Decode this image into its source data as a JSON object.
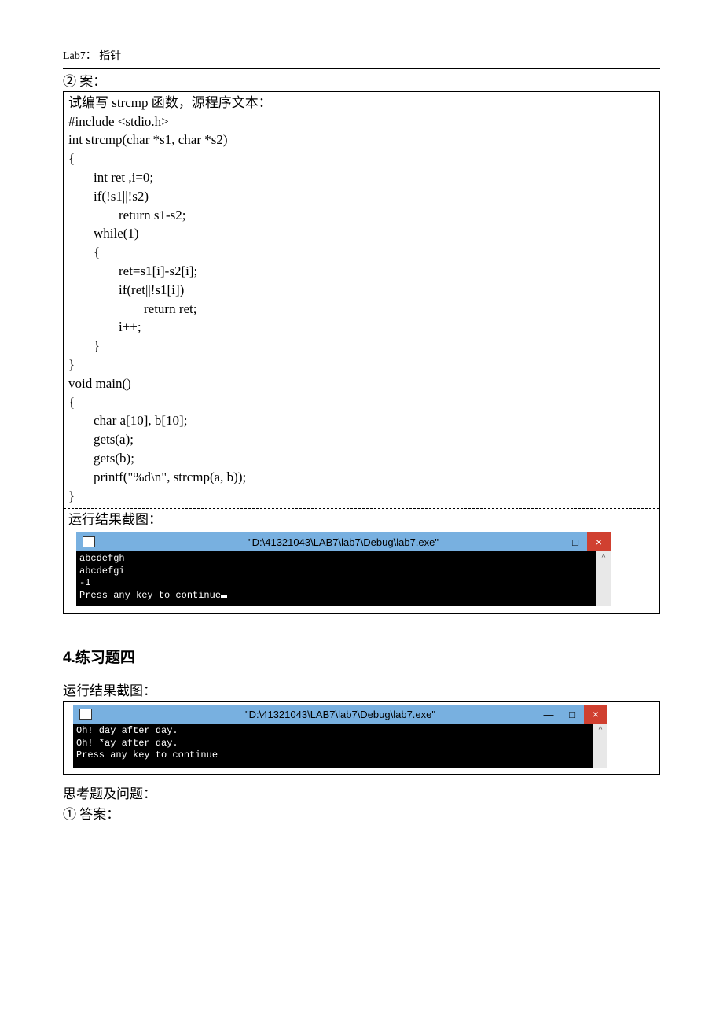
{
  "header": "Lab7：  指针",
  "item2_label": "② 案：",
  "box1": {
    "intro": "试编写 strcmp 函数，源程序文本：",
    "code": [
      {
        "t": "#include <stdio.h>",
        "i": 0
      },
      {
        "t": "int strcmp(char *s1, char *s2)",
        "i": 0
      },
      {
        "t": "{",
        "i": 0
      },
      {
        "t": "int ret ,i=0;",
        "i": 1
      },
      {
        "t": "if(!s1||!s2)",
        "i": 1
      },
      {
        "t": "return s1-s2;",
        "i": 2
      },
      {
        "t": "while(1)",
        "i": 1
      },
      {
        "t": "{",
        "i": 1
      },
      {
        "t": "ret=s1[i]-s2[i];",
        "i": 2
      },
      {
        "t": "if(ret||!s1[i])",
        "i": 2
      },
      {
        "t": "return ret;",
        "i": 3
      },
      {
        "t": "i++;",
        "i": 2
      },
      {
        "t": "}",
        "i": 1
      },
      {
        "t": "}",
        "i": 0
      },
      {
        "t": "void main()",
        "i": 0
      },
      {
        "t": "{",
        "i": 0
      },
      {
        "t": "char a[10], b[10];",
        "i": 1
      },
      {
        "t": "gets(a);",
        "i": 1
      },
      {
        "t": "gets(b);",
        "i": 1
      },
      {
        "t": "printf(\"%d\\n\", strcmp(a, b));",
        "i": 1
      },
      {
        "t": "}",
        "i": 0
      }
    ],
    "result_label": "运行结果截图：",
    "console_title": "\"D:\\41321043\\LAB7\\lab7\\Debug\\lab7.exe\"",
    "console_lines": "abcdefgh\nabcdefgi\n-1\nPress any key to continue"
  },
  "section4_title": "4.练习题四",
  "box2": {
    "result_label": "运行结果截图：",
    "console_title": "\"D:\\41321043\\LAB7\\lab7\\Debug\\lab7.exe\"",
    "console_lines": "Oh! day after day.\nOh! *ay after day.\nPress any key to continue"
  },
  "footer_q": "思考题及问题：",
  "footer_a": "① 答案：",
  "win_btn": {
    "min": "—",
    "max": "□",
    "close": "×",
    "up": "^"
  }
}
